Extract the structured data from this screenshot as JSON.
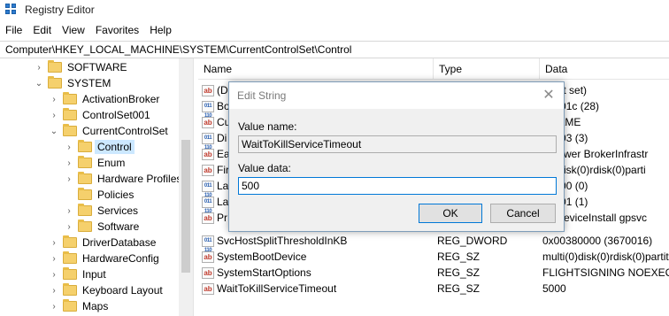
{
  "window": {
    "title": "Registry Editor"
  },
  "menu": [
    "File",
    "Edit",
    "View",
    "Favorites",
    "Help"
  ],
  "address": "Computer\\HKEY_LOCAL_MACHINE\\SYSTEM\\CurrentControlSet\\Control",
  "tree": {
    "nodes": [
      {
        "label": "SOFTWARE",
        "chevron": "›"
      },
      {
        "label": "SYSTEM",
        "chevron": "⌄"
      },
      {
        "label": "ActivationBroker",
        "chevron": "›"
      },
      {
        "label": "ControlSet001",
        "chevron": "›"
      },
      {
        "label": "CurrentControlSet",
        "chevron": "⌄"
      },
      {
        "label": "Control",
        "chevron": "›"
      },
      {
        "label": "Enum",
        "chevron": "›"
      },
      {
        "label": "Hardware Profiles",
        "chevron": "›"
      },
      {
        "label": "Policies",
        "chevron": ""
      },
      {
        "label": "Services",
        "chevron": "›"
      },
      {
        "label": "Software",
        "chevron": "›"
      },
      {
        "label": "DriverDatabase",
        "chevron": "›"
      },
      {
        "label": "HardwareConfig",
        "chevron": "›"
      },
      {
        "label": "Input",
        "chevron": "›"
      },
      {
        "label": "Keyboard Layout",
        "chevron": "›"
      },
      {
        "label": "Maps",
        "chevron": "›"
      }
    ]
  },
  "list": {
    "columns": [
      "Name",
      "Type",
      "Data"
    ],
    "rows": [
      {
        "icon": "string-value-icon",
        "name": "(D",
        "type": "",
        "data": "e not set)"
      },
      {
        "icon": "binary-value-icon",
        "name": "Bo",
        "type": "",
        "data": "00001c (28)"
      },
      {
        "icon": "string-value-icon",
        "name": "Cu",
        "type": "",
        "data": "RNAME"
      },
      {
        "icon": "binary-value-icon",
        "name": "Di",
        "type": "",
        "data": "00003 (3)"
      },
      {
        "icon": "string-value-icon",
        "name": "Ea",
        "type": "",
        "data": "s Power BrokerInfrastr"
      },
      {
        "icon": "string-value-icon",
        "name": "Fir",
        "type": "",
        "data": "i(0)disk(0)rdisk(0)parti"
      },
      {
        "icon": "binary-value-icon",
        "name": "La",
        "type": "",
        "data": "00000 (0)"
      },
      {
        "icon": "binary-value-icon",
        "name": "La",
        "type": "",
        "data": "00001 (1)"
      },
      {
        "icon": "string-value-icon",
        "name": "Pr",
        "type": "",
        "data": "vc DeviceInstall gpsvc"
      },
      {
        "icon": "binary-value-icon",
        "name": "SvcHostSplitThresholdInKB",
        "type": "REG_DWORD",
        "data": "0x00380000 (3670016)"
      },
      {
        "icon": "string-value-icon",
        "name": "SystemBootDevice",
        "type": "REG_SZ",
        "data": "multi(0)disk(0)rdisk(0)partit"
      },
      {
        "icon": "string-value-icon",
        "name": "SystemStartOptions",
        "type": "REG_SZ",
        "data": " FLIGHTSIGNING  NOEXECU"
      },
      {
        "icon": "string-value-icon",
        "name": "WaitToKillServiceTimeout",
        "type": "REG_SZ",
        "data": "5000"
      }
    ]
  },
  "dialog": {
    "title": "Edit String",
    "close": "✕",
    "value_name_label": "Value name:",
    "value_name": "WaitToKillServiceTimeout",
    "value_data_label": "Value data:",
    "value_data": "500",
    "ok_label": "OK",
    "cancel_label": "Cancel"
  },
  "colors": {
    "accent": "#0078d7",
    "selection": "#cce8ff",
    "folder": "#f5d06c"
  }
}
